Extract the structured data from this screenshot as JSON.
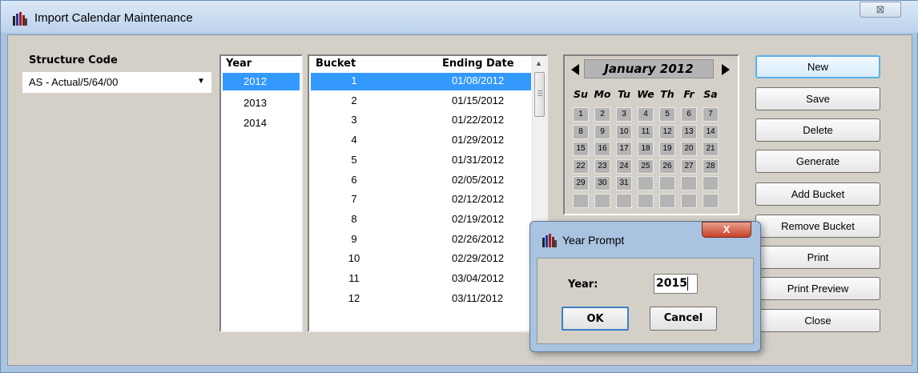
{
  "window": {
    "title": "Import Calendar Maintenance",
    "close_glyph": "⊠"
  },
  "structure": {
    "label": "Structure Code",
    "value": "AS - Actual/5/64/00"
  },
  "years": {
    "header": "Year",
    "items": [
      "2012",
      "2013",
      "2014"
    ],
    "selected_index": 0
  },
  "buckets": {
    "header_bucket": "Bucket",
    "header_date": "Ending Date",
    "rows": [
      {
        "bucket": "1",
        "date": "01/08/2012"
      },
      {
        "bucket": "2",
        "date": "01/15/2012"
      },
      {
        "bucket": "3",
        "date": "01/22/2012"
      },
      {
        "bucket": "4",
        "date": "01/29/2012"
      },
      {
        "bucket": "5",
        "date": "01/31/2012"
      },
      {
        "bucket": "6",
        "date": "02/05/2012"
      },
      {
        "bucket": "7",
        "date": "02/12/2012"
      },
      {
        "bucket": "8",
        "date": "02/19/2012"
      },
      {
        "bucket": "9",
        "date": "02/26/2012"
      },
      {
        "bucket": "10",
        "date": "02/29/2012"
      },
      {
        "bucket": "11",
        "date": "03/04/2012"
      },
      {
        "bucket": "12",
        "date": "03/11/2012"
      }
    ],
    "selected_index": 0
  },
  "calendar": {
    "month_label": "January 2012",
    "weekdays": [
      "Su",
      "Mo",
      "Tu",
      "We",
      "Th",
      "Fr",
      "Sa"
    ],
    "days": [
      "1",
      "2",
      "3",
      "4",
      "5",
      "6",
      "7",
      "8",
      "9",
      "10",
      "11",
      "12",
      "13",
      "14",
      "15",
      "16",
      "17",
      "18",
      "19",
      "20",
      "21",
      "22",
      "23",
      "24",
      "25",
      "26",
      "27",
      "28",
      "29",
      "30",
      "31"
    ]
  },
  "buttons": {
    "new": "New",
    "save": "Save",
    "delete": "Delete",
    "generate": "Generate",
    "add_bucket": "Add Bucket",
    "remove_bucket": "Remove Bucket",
    "print": "Print",
    "print_preview": "Print Preview",
    "close": "Close"
  },
  "dialog": {
    "title": "Year Prompt",
    "close_glyph": "X",
    "year_label": "Year:",
    "year_value": "2015",
    "ok": "OK",
    "cancel": "Cancel"
  },
  "colors": {
    "selection": "#3399ff",
    "window_frame": "#a9c3e0",
    "dialog_face": "#d4d0c8"
  }
}
